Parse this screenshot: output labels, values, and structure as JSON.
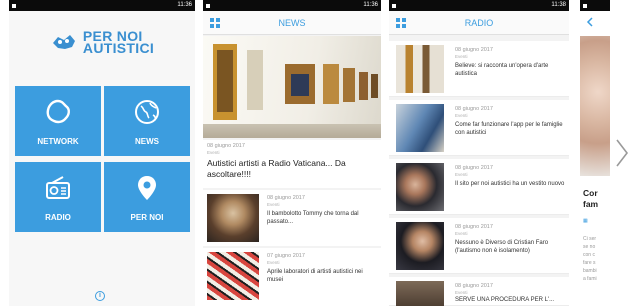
{
  "statusbar": {
    "time": "11:36",
    "time_alt": "11:38"
  },
  "home": {
    "logo_line1": "PER NOI",
    "logo_line2": "AUTISTICI",
    "tiles": [
      {
        "label": "NETWORK",
        "icon": "network-icon"
      },
      {
        "label": "NEWS",
        "icon": "globe-icon"
      },
      {
        "label": "RADIO",
        "icon": "radio-icon"
      },
      {
        "label": "PER NOI",
        "icon": "location-pin-icon"
      }
    ],
    "info_icon": "info-icon"
  },
  "news": {
    "title": "NEWS",
    "hero": {
      "date": "08 giugno 2017",
      "category": "Eventi",
      "title": "Autistici artisti a Radio Vaticana... Da ascoltare!!!!"
    },
    "items": [
      {
        "date": "08 giugno 2017",
        "category": "Eventi",
        "title": "Il bambolotto Tommy che torna dal passato..."
      },
      {
        "date": "07 giugno 2017",
        "category": "Eventi",
        "title": "Aprile laboratori di artisti autistici nei musei"
      }
    ]
  },
  "radio": {
    "title": "RADIO",
    "items": [
      {
        "date": "08 giugno 2017",
        "category": "Eventi",
        "title": "Believe: si racconta un'opera d'arte autistica"
      },
      {
        "date": "08 giugno 2017",
        "category": "Eventi",
        "title": "Come far funzionare l'app per le famiglie con autistici"
      },
      {
        "date": "08 giugno 2017",
        "category": "Eventi",
        "title": "Il sito per noi autistici ha un vestito nuovo"
      },
      {
        "date": "08 giugno 2017",
        "category": "Eventi",
        "title": "Nessuno è Diverso di Cristian Faro (l'autismo non è isolamento)"
      },
      {
        "date": "08 giugno 2017",
        "category": "Eventi",
        "title": "SERVE UNA PROCEDURA PER L'..."
      }
    ]
  },
  "detail": {
    "title_line1": "Cor",
    "title_line2": "fam",
    "small_lines": [
      "Ci ser",
      "se no",
      "con c",
      "fare s",
      "bambi",
      "a fami"
    ]
  },
  "colors": {
    "accent": "#3c9ddf",
    "statusbar": "#0b0b0b"
  }
}
